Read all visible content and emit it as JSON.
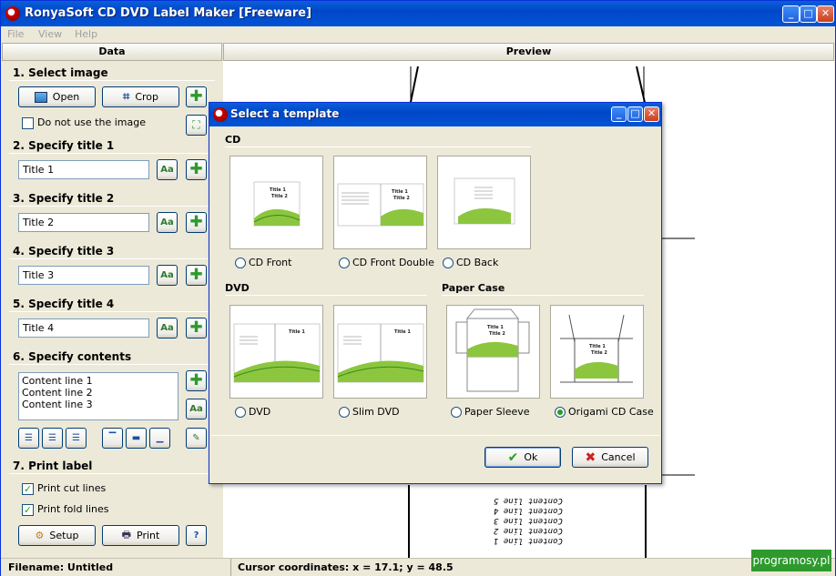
{
  "app": {
    "title": "RonyaSoft CD DVD Label Maker [Freeware]"
  },
  "window_buttons": {
    "minimize": "_",
    "maximize": "□",
    "close": "✕"
  },
  "menu": [
    "File",
    "View",
    "Help"
  ],
  "panels": {
    "data": "Data",
    "preview": "Preview"
  },
  "left": {
    "sec1": "1. Select image",
    "open": "Open",
    "crop": "Crop",
    "no_image": "Do not use the image",
    "sec2": "2. Specify title 1",
    "title1": "Title 1",
    "sec3": "3. Specify title 2",
    "title2": "Title 2",
    "sec4": "4. Specify title 3",
    "title3": "Title 3",
    "sec5": "5. Specify title 4",
    "title4": "Title 4",
    "sec6": "6. Specify contents",
    "contents": [
      "Content line 1",
      "Content line 2",
      "Content line 3"
    ],
    "sec7": "7. Print label",
    "print_cut": "Print cut lines",
    "print_fold": "Print fold lines",
    "print_cut_checked": true,
    "print_fold_checked": true,
    "setup": "Setup",
    "print": "Print",
    "font_button": "Aa"
  },
  "preview_text": [
    "Content line 5",
    "Content line 4",
    "Content line 3",
    "Content line 2",
    "Content line 1"
  ],
  "status": {
    "filename": "Filename: Untitled",
    "cursor": "Cursor coordinates: x =  17.1; y =  48.5"
  },
  "dialog": {
    "title": "Select a template",
    "cd_group": "CD",
    "dvd_group": "DVD",
    "paper_group": "Paper Case",
    "templates": {
      "cd_front": "CD Front",
      "cd_front_double": "CD Front Double",
      "cd_back": "CD Back",
      "dvd": "DVD",
      "slim_dvd": "Slim DVD",
      "paper_sleeve": "Paper Sleeve",
      "origami": "Origami CD Case"
    },
    "selected": "origami",
    "thumb_title1": "Title 1",
    "thumb_title2": "Title 2",
    "ok": "Ok",
    "cancel": "Cancel"
  },
  "watermark": "programosy.pl",
  "colors": {
    "titlebar": "#0047c8",
    "accent_green": "#2e9a2e",
    "panel": "#ece9d8"
  }
}
